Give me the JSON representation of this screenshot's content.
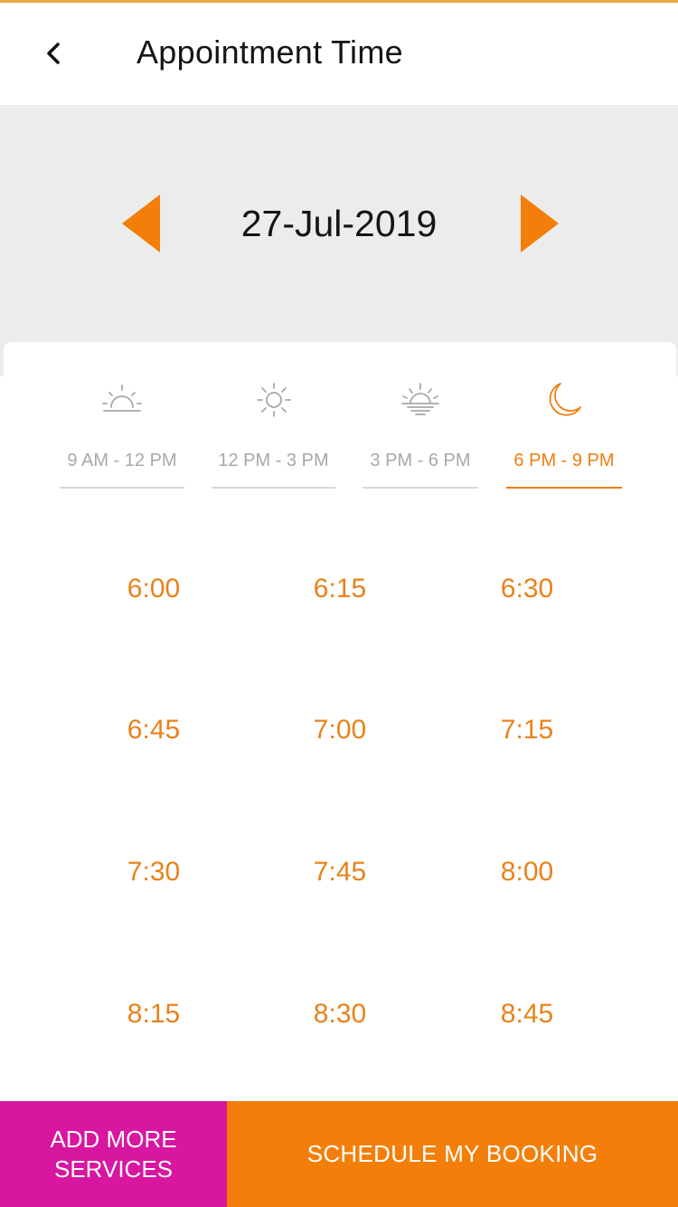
{
  "colors": {
    "accent": "#ef7d10",
    "inactive": "#a8a8a8",
    "add_button_bg": "#d816a0",
    "schedule_button_bg": "#f37f0a",
    "band_bg": "#ececec"
  },
  "header": {
    "back_icon": "chevron-left-icon",
    "title": "Appointment Time"
  },
  "date_picker": {
    "prev_icon": "triangle-left-icon",
    "next_icon": "triangle-right-icon",
    "date": "27-Jul-2019"
  },
  "periods": [
    {
      "icon": "sunrise-icon",
      "label": "9 AM - 12 PM",
      "active": false
    },
    {
      "icon": "sun-icon",
      "label": "12 PM - 3 PM",
      "active": false
    },
    {
      "icon": "sunset-icon",
      "label": "3 PM - 6 PM",
      "active": false
    },
    {
      "icon": "moon-icon",
      "label": "6 PM - 9 PM",
      "active": true
    }
  ],
  "slots": [
    "6:00",
    "6:15",
    "6:30",
    "6:45",
    "7:00",
    "7:15",
    "7:30",
    "7:45",
    "8:00",
    "8:15",
    "8:30",
    "8:45"
  ],
  "footer": {
    "add_label": "ADD MORE\nSERVICES",
    "schedule_label": "SCHEDULE MY BOOKING"
  }
}
